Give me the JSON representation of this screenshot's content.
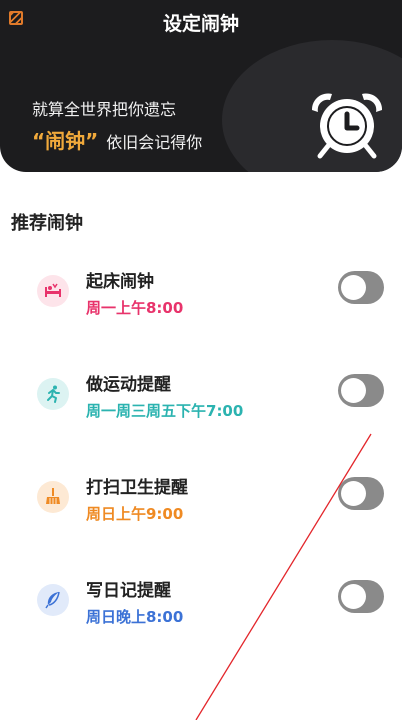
{
  "header": {
    "title": "设定闹钟",
    "slogan_line1": "就算全世界把你遗忘",
    "slogan_quote": "“闹钟”",
    "slogan_line2_rest": "依旧会记得你"
  },
  "section": {
    "title": "推荐闹钟"
  },
  "alarms": [
    {
      "name": "起床闹钟",
      "time": "周一上午8:00",
      "icon": "bed-icon",
      "color": "#e8336b",
      "bg": "#fde4ea",
      "enabled": false
    },
    {
      "name": "做运动提醒",
      "time": "周一周三周五下午7:00",
      "icon": "running-icon",
      "color": "#2bb3b0",
      "bg": "#dcf3f2",
      "enabled": false
    },
    {
      "name": "打扫卫生提醒",
      "time": "周日上午9:00",
      "icon": "broom-icon",
      "color": "#ef8a23",
      "bg": "#fde9d4",
      "enabled": false
    },
    {
      "name": "写日记提醒",
      "time": "周日晚上8:00",
      "icon": "feather-icon",
      "color": "#3c72d6",
      "bg": "#e1eafa",
      "enabled": false
    }
  ],
  "colors": {
    "header_bg": "#1c1c1e",
    "accent_quote": "#f0a93b",
    "toggle_off": "#8a8a8a"
  }
}
